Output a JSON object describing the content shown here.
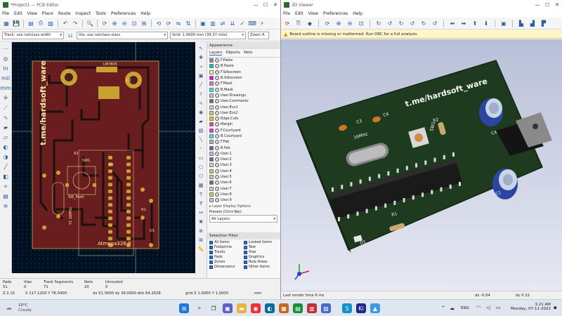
{
  "pcb_editor": {
    "title": "*Project1 — PCB Editor",
    "menu": [
      "File",
      "Edit",
      "View",
      "Place",
      "Route",
      "Inspect",
      "Tools",
      "Preferences",
      "Help"
    ],
    "track_select": "Track: use netclass width",
    "via_select": "Via: use netclass sizes",
    "grid_select": "Grid: 1.0000 mm (39.37 mils)",
    "zoom_select": "Zoom A",
    "board": {
      "silk_title": "t.me/hardsoft_ware",
      "chip_label": "Atmega328-P",
      "labels": [
        "C1",
        "LM7805",
        "C2",
        "C4",
        "R2",
        "SW1",
        "SW_Push",
        "U1",
        "C3",
        "Y1 16MHz",
        "C4",
        "R1",
        "D1",
        "LED_1"
      ]
    },
    "appearance": {
      "header": "Appearance",
      "tabs": [
        "Layers",
        "Objects",
        "Nets"
      ],
      "layers": [
        {
          "name": "F.Paste",
          "color": "#8a8a8a"
        },
        {
          "name": "B.Paste",
          "color": "#00c2c2"
        },
        {
          "name": "F.Silkscreen",
          "color": "#f2eda1"
        },
        {
          "name": "B.Silkscreen",
          "color": "#e800e8"
        },
        {
          "name": "F.Mask",
          "color": "#d86cd8"
        },
        {
          "name": "B.Mask",
          "color": "#02ffee"
        },
        {
          "name": "User.Drawings",
          "color": "#c2c2c2"
        },
        {
          "name": "User.Comments",
          "color": "#597099"
        },
        {
          "name": "User.Eco1",
          "color": "#b4dbd2"
        },
        {
          "name": "User.Eco2",
          "color": "#d8c852"
        },
        {
          "name": "Edge.Cuts",
          "color": "#d0d200"
        },
        {
          "name": "Margin",
          "color": "#ff26e2"
        },
        {
          "name": "F.Courtyard",
          "color": "#ff26e2"
        },
        {
          "name": "B.Courtyard",
          "color": "#26e9ff"
        },
        {
          "name": "F.Fab",
          "color": "#afafaf"
        },
        {
          "name": "B.Fab",
          "color": "#585dc8"
        },
        {
          "name": "User.1",
          "color": "#c2c2c2"
        },
        {
          "name": "User.2",
          "color": "#596e99"
        },
        {
          "name": "User.3",
          "color": "#b4dbd2"
        },
        {
          "name": "User.4",
          "color": "#d8c852"
        },
        {
          "name": "User.5",
          "color": "#c2c2c2"
        },
        {
          "name": "User.6",
          "color": "#596e99"
        },
        {
          "name": "User.7",
          "color": "#b4dbd2"
        },
        {
          "name": "User.8",
          "color": "#d8c852"
        },
        {
          "name": "User.9",
          "color": "#c2c2c2"
        }
      ],
      "display_options": "Layer Display Options",
      "presets_label": "Presets (Ctrl+Tab):",
      "presets_value": "All Layers"
    },
    "selection_filter": {
      "header": "Selection Filter",
      "items": [
        "All items",
        "Locked items",
        "Footprints",
        "Text",
        "Tracks",
        "Vias",
        "Pads",
        "Graphics",
        "Zones",
        "Rule Areas",
        "Dimensions",
        "Other items"
      ]
    },
    "status": {
      "pads_label": "Pads",
      "pads": "51",
      "vias_label": "Vias",
      "vias": "0",
      "tracks_label": "Track Segments",
      "tracks": "71",
      "nets_label": "Nets",
      "nets": "20",
      "unrouted_label": "Unrouted",
      "unrouted": "0",
      "zoom": "Z 2.15",
      "coords": "X 117.1200  Y 76.0400",
      "delta": "dx 51.0000  dy 39.0000  dist 64.2028",
      "grid": "grid X 1.0000  Y 1.0000",
      "units": "mm"
    }
  },
  "viewer": {
    "title": "3D Viewer",
    "menu": [
      "File",
      "Edit",
      "View",
      "Preferences",
      "Help"
    ],
    "warning": "Board outline is missing or malformed. Run DRC for a full analysis.",
    "board": {
      "silk_title": "t.me/hardsoft_ware",
      "labels": [
        "C3",
        "C4",
        "16MHz",
        "R2",
        "SW1",
        "C4",
        "C1",
        "R1",
        "D1"
      ]
    },
    "status": {
      "render": "Last render time 6 ms",
      "dx": "dx -0.04",
      "dy": "dy 0.22"
    }
  },
  "taskbar": {
    "weather_temp": "10°C",
    "weather_desc": "Cloudy",
    "lang": "ENG",
    "time": "3:21 AM",
    "date": "Monday, 07-11-2022"
  }
}
